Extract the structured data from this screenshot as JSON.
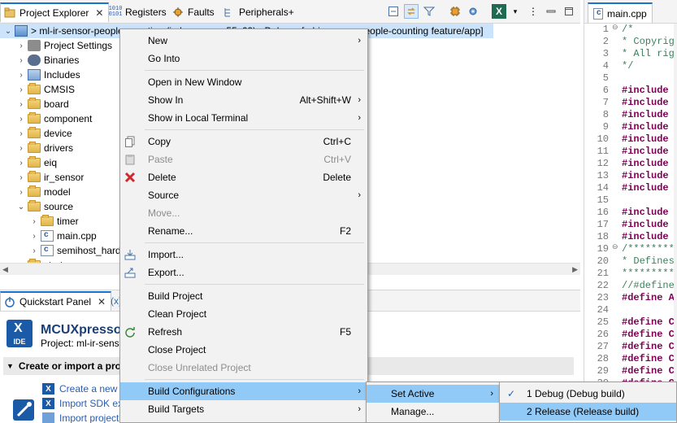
{
  "explorer": {
    "tabs": [
      {
        "label": "Project Explorer",
        "icon": "project-explorer-icon"
      },
      {
        "label": "Registers",
        "icon": "registers-icon"
      },
      {
        "label": "Faults",
        "icon": "faults-icon"
      },
      {
        "label": "Peripherals+",
        "icon": "peripherals-icon"
      }
    ],
    "close_glyph": "✕",
    "tree": [
      {
        "label": "> ml-ir-sensor-people-counting (in lpcxpresso55s69) <Debug> [ml-ir-sensor-people-counting feature/app]",
        "icon": "project-icon",
        "indent": 0,
        "twisty": "v"
      },
      {
        "label": "Project Settings",
        "icon": "settings-icon",
        "indent": 1,
        "twisty": ">"
      },
      {
        "label": "Binaries",
        "icon": "binaries-icon",
        "indent": 1,
        "twisty": ">"
      },
      {
        "label": "Includes",
        "icon": "includes-icon",
        "indent": 1,
        "twisty": ">"
      },
      {
        "label": "CMSIS",
        "icon": "folder-icon",
        "indent": 1,
        "twisty": ">"
      },
      {
        "label": "board",
        "icon": "folder-icon",
        "indent": 1,
        "twisty": ">"
      },
      {
        "label": "component",
        "icon": "folder-icon",
        "indent": 1,
        "twisty": ">"
      },
      {
        "label": "device",
        "icon": "folder-icon",
        "indent": 1,
        "twisty": ">"
      },
      {
        "label": "drivers",
        "icon": "folder-icon",
        "indent": 1,
        "twisty": ">"
      },
      {
        "label": "eiq",
        "icon": "folder-icon",
        "indent": 1,
        "twisty": ">"
      },
      {
        "label": "ir_sensor",
        "icon": "folder-icon",
        "indent": 1,
        "twisty": ">"
      },
      {
        "label": "model",
        "icon": "folder-icon",
        "indent": 1,
        "twisty": ">"
      },
      {
        "label": "source",
        "icon": "folder-icon",
        "indent": 1,
        "twisty": "v"
      },
      {
        "label": "timer",
        "icon": "folder-icon",
        "indent": 2,
        "twisty": ">"
      },
      {
        "label": "main.cpp",
        "icon": "source-file-icon",
        "indent": 2,
        "twisty": ">"
      },
      {
        "label": "semihost_hardfault.c",
        "icon": "source-file-icon",
        "indent": 2,
        "twisty": ">"
      },
      {
        "label": "startup",
        "icon": "folder-icon",
        "indent": 1,
        "twisty": ">"
      }
    ]
  },
  "quickstart": {
    "tab_label": "Quickstart Panel",
    "second_tab": "(x)",
    "product": "MCUXpresso",
    "logo_text": "IDE",
    "project_line": "Project: ml-ir-sens",
    "section_title": "Create or import a pro",
    "links": [
      "Create a new C",
      "Import SDK ex",
      "Import project"
    ]
  },
  "editor": {
    "tab_label": "main.cpp",
    "lines": [
      {
        "n": "1",
        "t": "/*",
        "c": "cmt",
        "fold": "⊖"
      },
      {
        "n": "2",
        "t": " * Copyrig",
        "c": "cmt"
      },
      {
        "n": "3",
        "t": " * All rig",
        "c": "cmt"
      },
      {
        "n": "4",
        "t": " */",
        "c": "cmt"
      },
      {
        "n": "5",
        "t": "",
        "c": ""
      },
      {
        "n": "6",
        "t": "#include <",
        "c": "kw"
      },
      {
        "n": "7",
        "t": "#include \"",
        "c": "kw"
      },
      {
        "n": "8",
        "t": "#include \"",
        "c": "kw"
      },
      {
        "n": "9",
        "t": "#include \"",
        "c": "kw"
      },
      {
        "n": "10",
        "t": "#include \"",
        "c": "kw"
      },
      {
        "n": "11",
        "t": "#include \"",
        "c": "kw"
      },
      {
        "n": "12",
        "t": "#include \"",
        "c": "kw"
      },
      {
        "n": "13",
        "t": "#include \"",
        "c": "kw"
      },
      {
        "n": "14",
        "t": "#include \"",
        "c": "kw"
      },
      {
        "n": "15",
        "t": "",
        "c": ""
      },
      {
        "n": "16",
        "t": "#include \"",
        "c": "kw"
      },
      {
        "n": "17",
        "t": "#include \"",
        "c": "kw"
      },
      {
        "n": "18",
        "t": "#include \"",
        "c": "kw"
      },
      {
        "n": "19",
        "t": "/*********",
        "c": "cmt",
        "fold": "⊖"
      },
      {
        "n": "20",
        "t": " * Defines",
        "c": "cmt"
      },
      {
        "n": "21",
        "t": " *********",
        "c": "cmt"
      },
      {
        "n": "22",
        "t": "//#define ",
        "c": "cmt"
      },
      {
        "n": "23",
        "t": "#define AP",
        "c": "kw"
      },
      {
        "n": "24",
        "t": "",
        "c": ""
      },
      {
        "n": "25",
        "t": "#define CT",
        "c": "kw"
      },
      {
        "n": "26",
        "t": "#define CT",
        "c": "kw"
      },
      {
        "n": "27",
        "t": "#define CT",
        "c": "kw"
      },
      {
        "n": "28",
        "t": "#define CT",
        "c": "kw"
      },
      {
        "n": "29",
        "t": "#define CT",
        "c": "kw"
      },
      {
        "n": "30",
        "t": "#define CT",
        "c": "kw"
      },
      {
        "n": "31",
        "t": "#define CT",
        "c": "kw"
      }
    ]
  },
  "context_menu": {
    "items": [
      {
        "label": "New",
        "shortcut": "",
        "submenu": true,
        "icon": "",
        "disabled": false
      },
      {
        "label": "Go Into",
        "shortcut": "",
        "submenu": false,
        "icon": "",
        "disabled": false
      },
      {
        "sep": true
      },
      {
        "label": "Open in New Window",
        "shortcut": "",
        "submenu": false,
        "icon": "",
        "disabled": false
      },
      {
        "label": "Show In",
        "shortcut": "Alt+Shift+W",
        "submenu": true,
        "icon": "",
        "disabled": false
      },
      {
        "label": "Show in Local Terminal",
        "shortcut": "",
        "submenu": true,
        "icon": "",
        "disabled": false
      },
      {
        "sep": true
      },
      {
        "label": "Copy",
        "shortcut": "Ctrl+C",
        "submenu": false,
        "icon": "copy-icon",
        "disabled": false
      },
      {
        "label": "Paste",
        "shortcut": "Ctrl+V",
        "submenu": false,
        "icon": "paste-icon",
        "disabled": true
      },
      {
        "label": "Delete",
        "shortcut": "Delete",
        "submenu": false,
        "icon": "delete-icon",
        "disabled": false
      },
      {
        "label": "Source",
        "shortcut": "",
        "submenu": true,
        "icon": "",
        "disabled": false
      },
      {
        "label": "Move...",
        "shortcut": "",
        "submenu": false,
        "icon": "",
        "disabled": true
      },
      {
        "label": "Rename...",
        "shortcut": "F2",
        "submenu": false,
        "icon": "",
        "disabled": false
      },
      {
        "sep": true
      },
      {
        "label": "Import...",
        "shortcut": "",
        "submenu": false,
        "icon": "import-icon",
        "disabled": false
      },
      {
        "label": "Export...",
        "shortcut": "",
        "submenu": false,
        "icon": "export-icon",
        "disabled": false
      },
      {
        "sep": true
      },
      {
        "label": "Build Project",
        "shortcut": "",
        "submenu": false,
        "icon": "",
        "disabled": false
      },
      {
        "label": "Clean Project",
        "shortcut": "",
        "submenu": false,
        "icon": "",
        "disabled": false
      },
      {
        "label": "Refresh",
        "shortcut": "F5",
        "submenu": false,
        "icon": "refresh-icon",
        "disabled": false
      },
      {
        "label": "Close Project",
        "shortcut": "",
        "submenu": false,
        "icon": "",
        "disabled": false
      },
      {
        "label": "Close Unrelated Project",
        "shortcut": "",
        "submenu": false,
        "icon": "",
        "disabled": true
      },
      {
        "sep": true
      },
      {
        "label": "Build Configurations",
        "shortcut": "",
        "submenu": true,
        "icon": "",
        "disabled": false,
        "highlight": true
      },
      {
        "label": "Build Targets",
        "shortcut": "",
        "submenu": true,
        "icon": "",
        "disabled": false
      }
    ]
  },
  "build_config_menu": {
    "items": [
      {
        "label": "Set Active",
        "submenu": true,
        "highlight": true
      },
      {
        "label": "Manage...",
        "submenu": false,
        "highlight": false
      }
    ]
  },
  "set_active_menu": {
    "items": [
      {
        "label": "1 Debug (Debug build)",
        "checked": true,
        "highlight": false
      },
      {
        "label": "2 Release (Release build)",
        "checked": false,
        "highlight": true
      }
    ]
  },
  "colors": {
    "highlight": "#91c9f7",
    "menu_bg": "#f2f2f2",
    "selection": "#cce4fb",
    "accent": "#1a73d1"
  }
}
